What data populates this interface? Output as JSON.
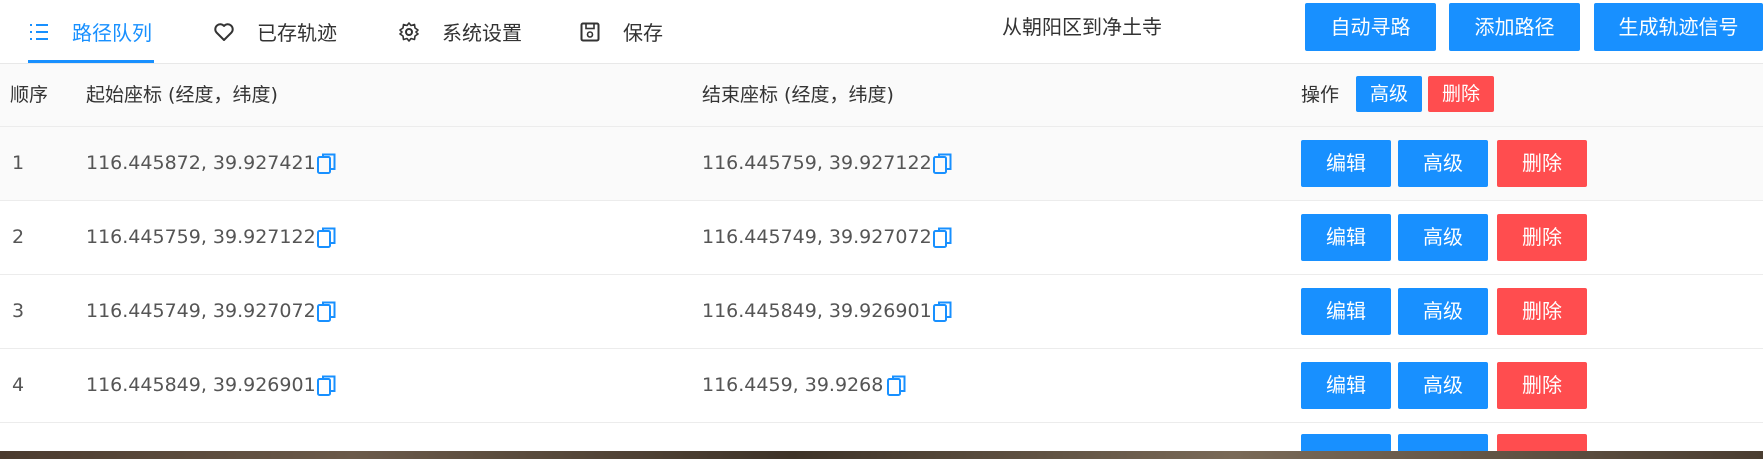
{
  "nav": {
    "tabs": [
      {
        "label": "路径队列",
        "icon": "list-icon",
        "active": true
      },
      {
        "label": "已存轨迹",
        "icon": "heart-icon",
        "active": false
      },
      {
        "label": "系统设置",
        "icon": "gear-icon",
        "active": false
      },
      {
        "label": "保存",
        "icon": "save-icon",
        "active": false
      }
    ],
    "route_title": "从朝阳区到净土寺",
    "buttons": {
      "auto_route": "自动寻路",
      "add_route": "添加路径",
      "generate_signal": "生成轨迹信号"
    }
  },
  "table": {
    "headers": {
      "order": "顺序",
      "start": "起始座标 (经度，纬度)",
      "end": "结束座标 (经度，纬度)",
      "actions": "操作",
      "advanced": "高级",
      "delete": "删除"
    },
    "rows": [
      {
        "order": "1",
        "start": "116.445872, 39.927421",
        "end": "116.445759, 39.927122"
      },
      {
        "order": "2",
        "start": "116.445759, 39.927122",
        "end": "116.445749, 39.927072"
      },
      {
        "order": "3",
        "start": "116.445749, 39.927072",
        "end": "116.445849, 39.926901"
      },
      {
        "order": "4",
        "start": "116.445849, 39.926901",
        "end": "116.4459, 39.9268"
      }
    ],
    "row_actions": {
      "edit": "编辑",
      "advanced": "高级",
      "delete": "删除"
    }
  },
  "colors": {
    "primary": "#1890ff",
    "danger": "#ff4d4f"
  }
}
